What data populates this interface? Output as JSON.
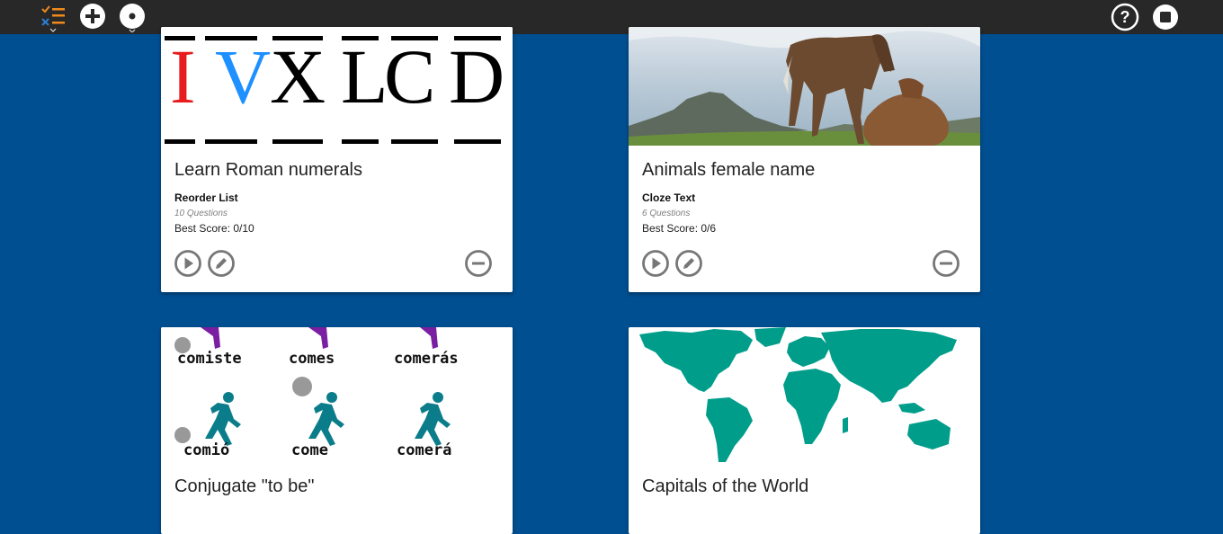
{
  "toolbar": {
    "icons": [
      "checklist-icon",
      "add-icon",
      "toggle-view-icon",
      "help-icon",
      "stop-icon"
    ],
    "colors": {
      "background": "#282828",
      "icon": "#ffffff",
      "accent_orange": "#f08a1c",
      "accent_blue": "#2a7fd4"
    }
  },
  "page": {
    "background": "#004f91"
  },
  "cards": [
    {
      "title": "Learn Roman numerals",
      "type": "Reorder List",
      "questions": "10 Questions",
      "best_score": "Best Score: 0/10",
      "image": {
        "kind": "roman-numerals",
        "letters": [
          {
            "char": "I",
            "color": "#e81c1c"
          },
          {
            "char": "V",
            "color": "#1e90ff"
          },
          {
            "char": "X",
            "color": "#000000"
          },
          {
            "char": "L",
            "color": "#000000"
          },
          {
            "char": "C",
            "color": "#000000"
          },
          {
            "char": "D",
            "color": "#000000"
          }
        ]
      }
    },
    {
      "title": "Animals female name",
      "type": "Cloze Text",
      "questions": "6 Questions",
      "best_score": "Best Score: 0/6",
      "image": {
        "kind": "horses-photo"
      }
    },
    {
      "title": "Conjugate \"to be\"",
      "image": {
        "kind": "spanish-verbs",
        "words": [
          "comiste",
          "comes",
          "comerás",
          "comió",
          "come",
          "comerá"
        ]
      }
    },
    {
      "title": "Capitals of the World",
      "image": {
        "kind": "world-map",
        "land_color": "#009e8a"
      }
    }
  ],
  "actions": {
    "icons": [
      "play-icon",
      "edit-icon",
      "remove-icon"
    ],
    "color": "#777777"
  }
}
